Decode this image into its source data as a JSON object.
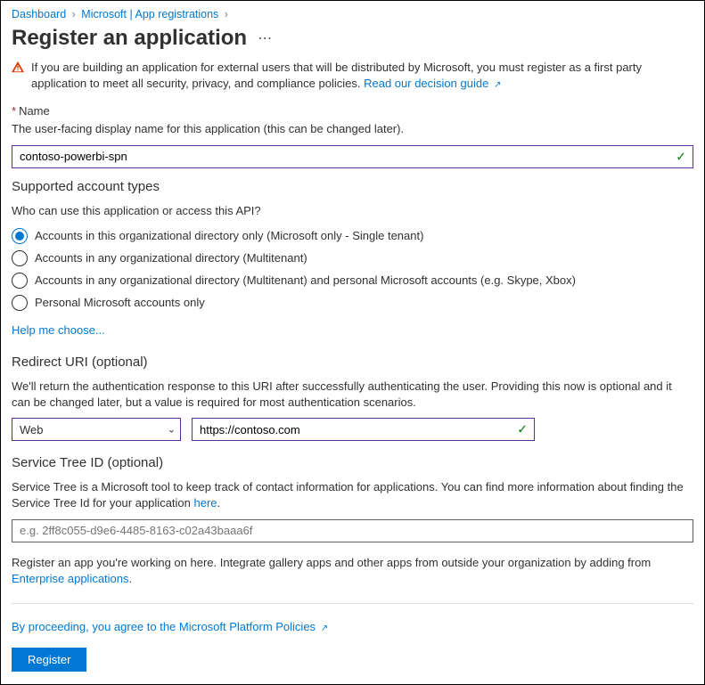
{
  "breadcrumb": {
    "items": [
      "Dashboard",
      "Microsoft | App registrations"
    ]
  },
  "title": "Register an application",
  "alert": {
    "text": "If you are building an application for external users that will be distributed by Microsoft, you must register as a first party application to meet all security, privacy, and compliance policies.",
    "link": "Read our decision guide"
  },
  "name_section": {
    "label": "Name",
    "desc": "The user-facing display name for this application (this can be changed later).",
    "value": "contoso-powerbi-spn"
  },
  "account_types": {
    "heading": "Supported account types",
    "question": "Who can use this application or access this API?",
    "options": [
      "Accounts in this organizational directory only (Microsoft only - Single tenant)",
      "Accounts in any organizational directory (Multitenant)",
      "Accounts in any organizational directory (Multitenant) and personal Microsoft accounts (e.g. Skype, Xbox)",
      "Personal Microsoft accounts only"
    ],
    "selected": 0,
    "help": "Help me choose..."
  },
  "redirect": {
    "heading": "Redirect URI (optional)",
    "desc": "We'll return the authentication response to this URI after successfully authenticating the user. Providing this now is optional and it can be changed later, but a value is required for most authentication scenarios.",
    "platform": "Web",
    "uri": "https://contoso.com"
  },
  "service_tree": {
    "heading": "Service Tree ID (optional)",
    "desc_prefix": "Service Tree is a Microsoft tool to keep track of contact information for applications. You can find more information about finding the Service Tree Id for your application ",
    "desc_link": "here",
    "placeholder": "e.g. 2ff8c055-d9e6-4485-8163-c02a43baaa6f"
  },
  "footer_note": {
    "text": "Register an app you're working on here. Integrate gallery apps and other apps from outside your organization by adding from ",
    "link": "Enterprise applications"
  },
  "policy": {
    "text": "By proceeding, you agree to the Microsoft Platform Policies"
  },
  "register_button": "Register"
}
